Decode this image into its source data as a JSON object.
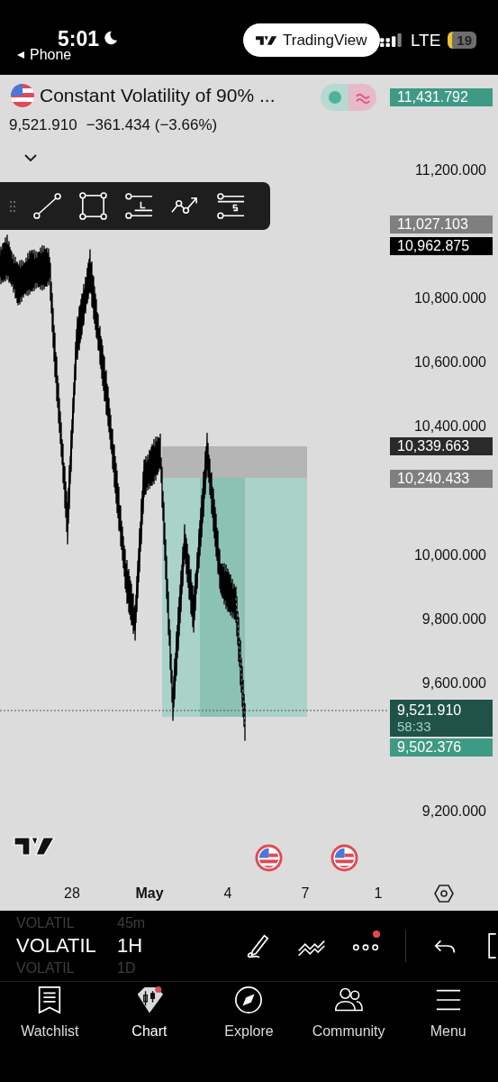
{
  "status_bar": {
    "time": "5:01",
    "back": "Phone",
    "app": "TradingView",
    "network": "LTE",
    "battery": "19"
  },
  "symbol": {
    "title": "Constant Volatility of 90% ...",
    "last": "9,521.910",
    "change": "−361.434 (−3.66%)"
  },
  "price_axis": [
    "11,200.000",
    "10,800.000",
    "10,600.000",
    "10,400.000",
    "10,000.000",
    "9,800.000",
    "9,600.000",
    "9,200.000"
  ],
  "price_badges": [
    {
      "value": "11,431.792",
      "kind": "green"
    },
    {
      "value": "11,027.103",
      "kind": "gray"
    },
    {
      "value": "10,962.875",
      "kind": "black"
    },
    {
      "value": "10,339.663",
      "kind": "dark"
    },
    {
      "value": "10,240.433",
      "kind": "gray"
    },
    {
      "value": "9,521.910",
      "kind": "current",
      "countdown": "58:33"
    },
    {
      "value": "9,502.376",
      "kind": "green"
    }
  ],
  "time_axis": [
    {
      "label": "28",
      "bold": false
    },
    {
      "label": "May",
      "bold": true
    },
    {
      "label": "4",
      "bold": false
    },
    {
      "label": "7",
      "bold": false
    },
    {
      "label": "1",
      "bold": false
    }
  ],
  "bottom_toolbar": {
    "symbol": "VOLATIL",
    "interval": "1H",
    "picker_above": [
      "VOLATIL",
      "45m"
    ],
    "picker_below": [
      "VOLATIL",
      "1D"
    ],
    "more_badge": true
  },
  "tabs": [
    {
      "label": "Watchlist",
      "selected": false
    },
    {
      "label": "Chart",
      "selected": true
    },
    {
      "label": "Explore",
      "selected": false
    },
    {
      "label": "Community",
      "selected": false
    },
    {
      "label": "Menu",
      "selected": false
    }
  ]
}
